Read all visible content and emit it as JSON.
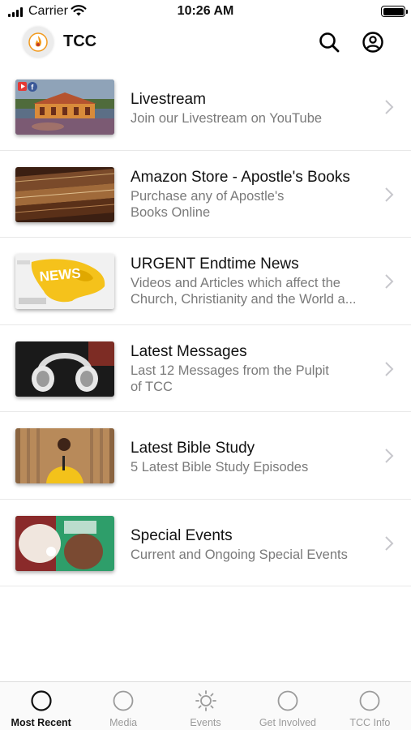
{
  "status": {
    "carrier": "Carrier",
    "time": "10:26 AM"
  },
  "header": {
    "title": "TCC",
    "logo_icon": "flame-logo-icon",
    "search_icon": "search-icon",
    "profile_icon": "user-circle-icon"
  },
  "feed": {
    "items": [
      {
        "title": "Livestream",
        "subtitle": "Join our Livestream on YouTube",
        "thumbnail": "church-building-image"
      },
      {
        "title": "Amazon Store - Apostle's Books",
        "subtitle_lines": [
          "Purchase any of Apostle's",
          "Books Online"
        ],
        "thumbnail": "books-image"
      },
      {
        "title": "URGENT Endtime News",
        "subtitle_lines": [
          "Videos and Articles which affect the",
          "Church, Christianity and the World a..."
        ],
        "thumbnail": "news-map-image"
      },
      {
        "title": "Latest Messages",
        "subtitle_lines": [
          "Last 12 Messages from the Pulpit",
          "of TCC"
        ],
        "thumbnail": "headphones-image"
      },
      {
        "title": "Latest Bible Study",
        "subtitle": "5 Latest Bible Study Episodes",
        "thumbnail": "speaker-image"
      },
      {
        "title": "Special Events",
        "subtitle": "Current and Ongoing Special Events",
        "thumbnail": "event-image"
      }
    ]
  },
  "tabbar": {
    "tabs": [
      {
        "label": "Most Recent",
        "icon": "circle-icon",
        "active": true
      },
      {
        "label": "Media",
        "icon": "circle-icon",
        "active": false
      },
      {
        "label": "Events",
        "icon": "sun-icon",
        "active": false
      },
      {
        "label": "Get Involved",
        "icon": "circle-icon",
        "active": false
      },
      {
        "label": "TCC Info",
        "icon": "circle-icon",
        "active": false
      }
    ]
  },
  "colors": {
    "accent": "#111111",
    "inactive": "#9b9b9b",
    "subtitle": "#7a7a7a",
    "logo_flame": "#f29a1d"
  }
}
